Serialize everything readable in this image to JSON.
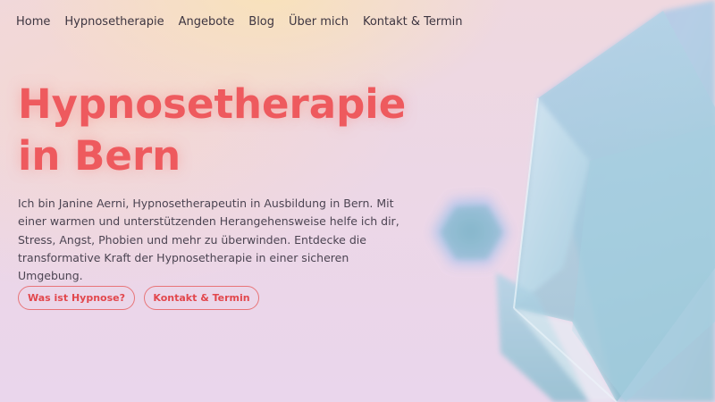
{
  "nav": {
    "items": [
      {
        "label": "Home"
      },
      {
        "label": "Hypnosetherapie"
      },
      {
        "label": "Angebote"
      },
      {
        "label": "Blog"
      },
      {
        "label": "Über mich"
      },
      {
        "label": "Kontakt & Termin"
      }
    ]
  },
  "hero": {
    "title_line1": "Hypnosetherapie",
    "title_line2": "in Bern",
    "intro": "Ich bin Janine Aerni, Hypnosetherapeutin in Ausbildung in Bern. Mit einer warmen und unterstützenden Herangehensweise helfe ich dir, Stress, Angst, Phobien und mehr zu überwinden. Entdecke die transformative Kraft der Hypnosetherapie in einer sicheren Umgebung.",
    "buttons": {
      "primary": "Was ist Hypnose?",
      "secondary": "Kontakt & Termin"
    }
  },
  "colors": {
    "accent": "#ee5a5e",
    "button_text": "#e2474d",
    "crystal": "#a9cde0"
  },
  "decorations": {
    "icons": [
      "large-crystal-shape",
      "small-hexagon-crystal"
    ]
  }
}
